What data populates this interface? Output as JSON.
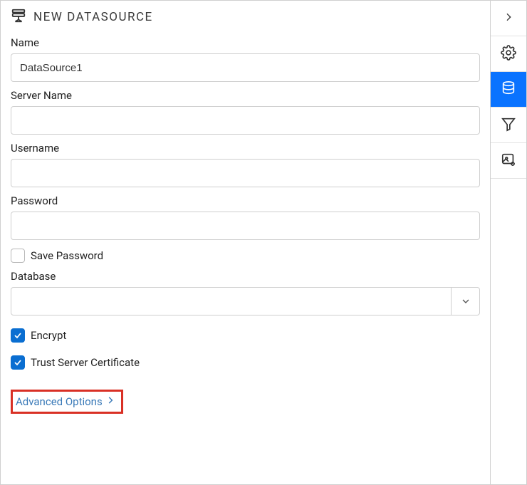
{
  "header": {
    "title": "NEW DATASOURCE"
  },
  "fields": {
    "name": {
      "label": "Name",
      "value": "DataSource1"
    },
    "server": {
      "label": "Server Name",
      "value": ""
    },
    "username": {
      "label": "Username",
      "value": ""
    },
    "password": {
      "label": "Password",
      "value": ""
    },
    "savePwd": {
      "label": "Save Password",
      "checked": false
    },
    "database": {
      "label": "Database",
      "value": ""
    },
    "encrypt": {
      "label": "Encrypt",
      "checked": true
    },
    "trust": {
      "label": "Trust Server Certificate",
      "checked": true
    }
  },
  "advanced": {
    "label": "Advanced Options"
  },
  "sidebar": {
    "items": [
      {
        "name": "collapse",
        "active": false
      },
      {
        "name": "settings",
        "active": false
      },
      {
        "name": "datasource",
        "active": true
      },
      {
        "name": "filter",
        "active": false
      },
      {
        "name": "image",
        "active": false
      }
    ]
  },
  "colors": {
    "accent": "#0a6ed1",
    "activeTab": "#0a73ff",
    "highlightBorder": "#d93025",
    "link": "#3a7ab8"
  }
}
